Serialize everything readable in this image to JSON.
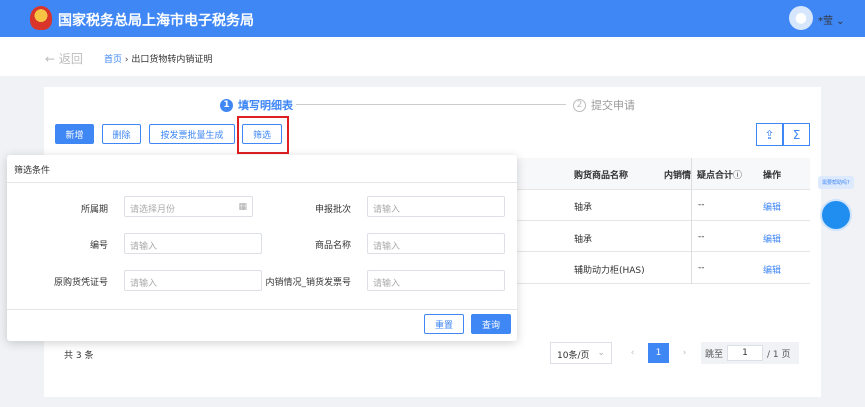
{
  "header": {
    "title": "国家税务总局上海市电子税务局",
    "user": "*莹",
    "avatar_icon": "user-icon"
  },
  "breadcrumb": {
    "back": "返回",
    "home": "首页",
    "current": "出口货物转内销证明"
  },
  "steps": [
    {
      "num": "1",
      "label": "填写明细表",
      "active": true
    },
    {
      "num": "2",
      "label": "提交申请",
      "active": false
    }
  ],
  "toolbar": {
    "add": "新增",
    "delete": "删除",
    "batch": "按发票批量生成",
    "filter": "筛选",
    "export_icon": "export-icon",
    "sum_icon": "sigma-icon"
  },
  "table": {
    "headers": [
      "购货商品名称",
      "内销情",
      "疑点合计",
      "操作"
    ],
    "rows": [
      {
        "name": "轴承",
        "doubt": "--",
        "action": "编辑"
      },
      {
        "name": "轴承",
        "doubt": "--",
        "action": "编辑"
      },
      {
        "name": "辅助动力柜(HAS)",
        "doubt": "--",
        "action": "编辑"
      }
    ]
  },
  "filter": {
    "title": "筛选条件",
    "fields": [
      {
        "label": "所属期",
        "placeholder": "请选择月份"
      },
      {
        "label": "申报批次",
        "placeholder": "请输入"
      },
      {
        "label": "编号",
        "placeholder": "请输入"
      },
      {
        "label": "商品名称",
        "placeholder": "请输入"
      },
      {
        "label": "原购货凭证号",
        "placeholder": "请输入"
      },
      {
        "label": "内销情况_销货发票号",
        "placeholder": "请输入"
      }
    ],
    "reset": "重置",
    "query": "查询"
  },
  "pagination": {
    "total": "共 3 条",
    "page_size": "10条/页",
    "current": "1",
    "jump_label": "跳至",
    "jump_value": "1",
    "pages": "/ 1 页"
  },
  "assistant": {
    "bubble": "需要帮助吗?"
  },
  "colors": {
    "primary": "#3f87f5",
    "highlight": "#e02020"
  }
}
